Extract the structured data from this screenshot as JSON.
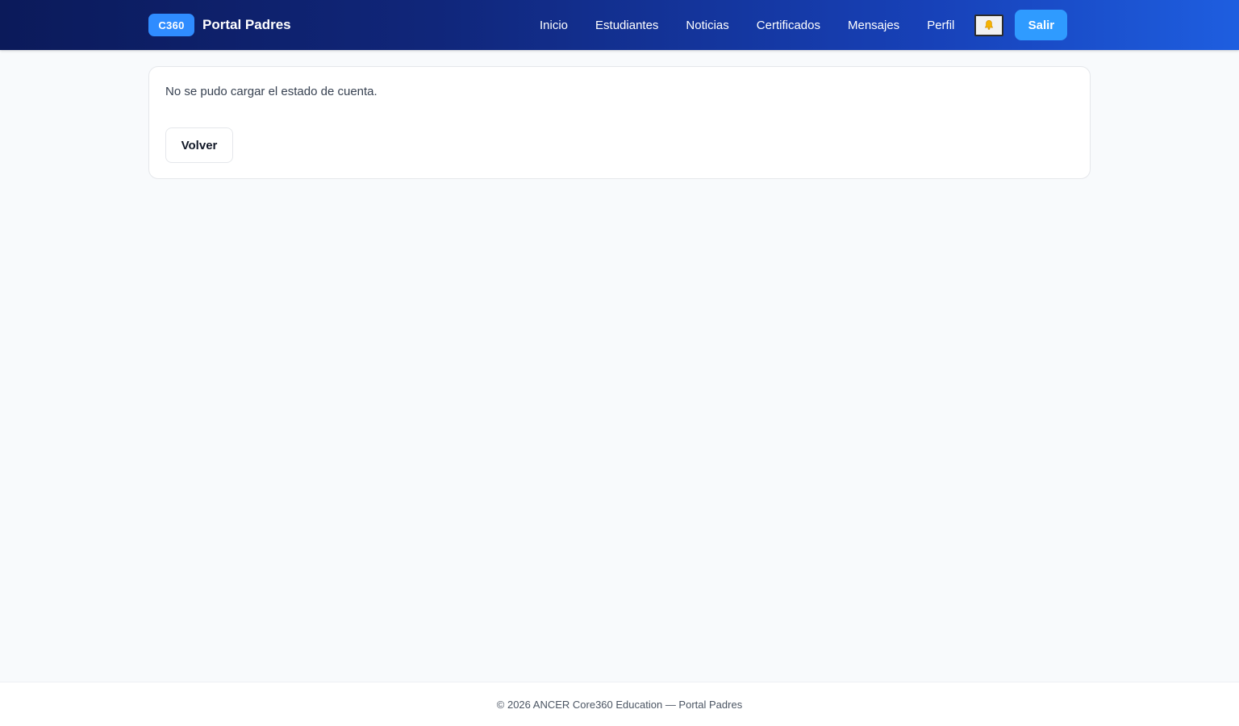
{
  "header": {
    "brand_badge": "C360",
    "brand_name": "Portal Padres",
    "nav": [
      "Inicio",
      "Estudiantes",
      "Noticias",
      "Certificados",
      "Mensajes",
      "Perfil"
    ],
    "notifications_icon": "bell-icon",
    "logout_label": "Salir"
  },
  "main": {
    "error_message": "No se pudo cargar el estado de cuenta.",
    "back_label": "Volver"
  },
  "footer": {
    "text": "© 2026 ANCER Core360 Education — Portal Padres"
  },
  "colors": {
    "header_start": "#0b1a5a",
    "header_end": "#1e5ee0",
    "accent": "#2f8cff",
    "page_bg": "#f8fafc"
  }
}
